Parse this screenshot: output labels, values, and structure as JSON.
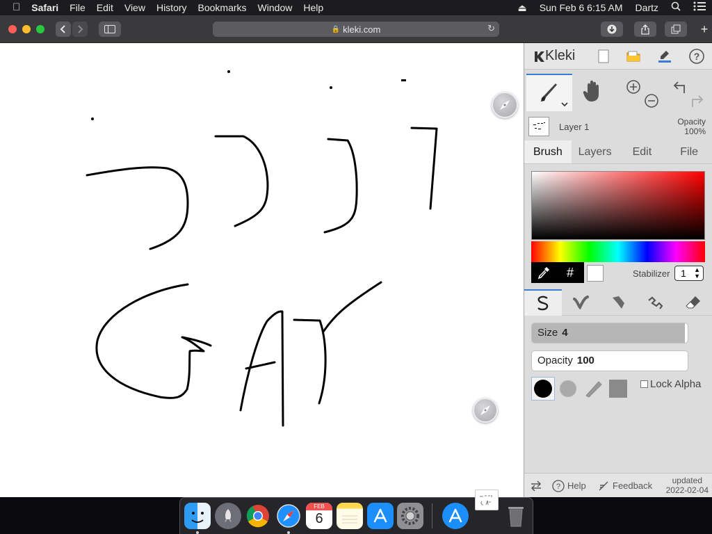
{
  "menubar": {
    "apple_icon": "",
    "app_name": "Safari",
    "menus": [
      "File",
      "Edit",
      "View",
      "History",
      "Bookmarks",
      "Window",
      "Help"
    ],
    "status": {
      "datetime": "Sun Feb 6  6:15 AM",
      "user": "Dartz"
    },
    "status_icons": [
      "eject-icon",
      "search-icon",
      "list-icon"
    ]
  },
  "browser": {
    "url": "kleki.com",
    "buttons": [
      "close",
      "minimize",
      "zoom",
      "back",
      "forward",
      "sidebar",
      "reload",
      "downloads",
      "share",
      "tabs",
      "new-tab"
    ],
    "colors": {
      "close": "#fe5f57",
      "minimize": "#febc2e",
      "zoom": "#28c840"
    }
  },
  "kleki": {
    "logo": "Kleki",
    "top_icons": [
      "new-image-icon",
      "folder-icon",
      "color-icon",
      "help-icon"
    ],
    "tools": [
      "brush-tool",
      "hand-tool",
      "zoom-in",
      "zoom-out",
      "undo",
      "redo"
    ],
    "layer": {
      "name": "Layer 1",
      "opacity_label": "Opacity",
      "opacity_value": "100%"
    },
    "tabs": [
      "Brush",
      "Layers",
      "Edit",
      "File"
    ],
    "active_tab": "Brush",
    "color": {
      "current": "#000000",
      "secondary": "#ffffff",
      "hue": "#ff0000",
      "hex_label": "#"
    },
    "stabilizer": {
      "label": "Stabilizer",
      "value": "1"
    },
    "brush_types": [
      "pen",
      "blend",
      "sketchy",
      "pixel",
      "eraser"
    ],
    "size": {
      "label": "Size",
      "value": "4",
      "fraction": 0.98
    },
    "opacity": {
      "label": "Opacity",
      "value": "100",
      "fraction": 0.0
    },
    "lock_alpha": {
      "label": "Lock Alpha",
      "checked": false
    },
    "footer": {
      "help": "Help",
      "feedback": "Feedback",
      "updated_label": "updated",
      "updated_date": "2022-02-04"
    }
  },
  "dock": {
    "apps": [
      "Finder",
      "Launchpad",
      "Chrome",
      "Safari",
      "Calendar",
      "Notes",
      "App Store",
      "System Preferences",
      "App Store",
      "Trash"
    ],
    "calendar": {
      "month": "FEB",
      "day": "6"
    }
  }
}
